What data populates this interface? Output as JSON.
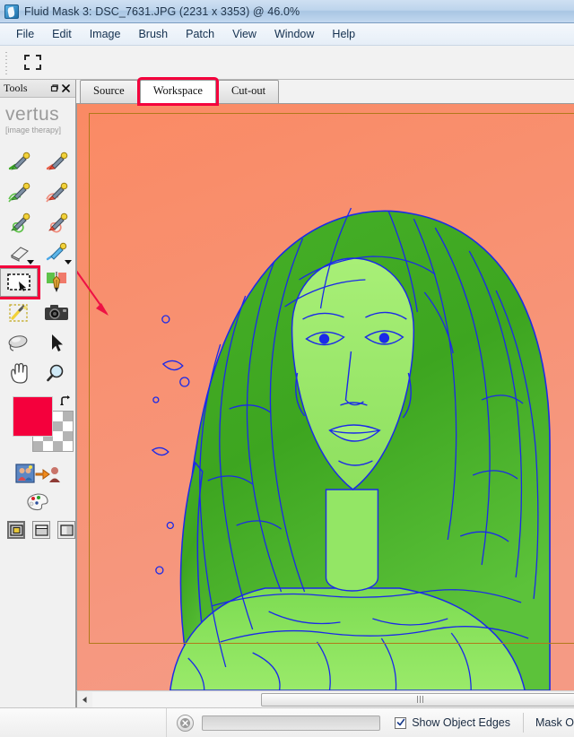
{
  "window": {
    "title": "Fluid Mask 3: DSC_7631.JPG (2231 x 3353) @ 46.0%",
    "app_icon": "fluid-mask-app-icon"
  },
  "menubar": {
    "items": [
      {
        "label": "File"
      },
      {
        "label": "Edit"
      },
      {
        "label": "Image"
      },
      {
        "label": "Brush"
      },
      {
        "label": "Patch"
      },
      {
        "label": "View"
      },
      {
        "label": "Window"
      },
      {
        "label": "Help"
      }
    ]
  },
  "toolstrip": {
    "grip": "drag-grip",
    "buttons": [
      {
        "name": "marquee-select-button",
        "icon": "dashed-rectangle-icon"
      }
    ]
  },
  "tools_panel": {
    "title": "Tools",
    "restore_icon": "restore-window-icon",
    "close_icon": "close-icon",
    "brand": {
      "name": "vertus",
      "tagline": "[image therapy]"
    },
    "tools": [
      {
        "name": "keep-marker-tool",
        "icon": "green-marker-pen-icon",
        "selected": false
      },
      {
        "name": "delete-marker-tool",
        "icon": "red-marker-pen-icon",
        "selected": false
      },
      {
        "name": "keep-edge-marker-tool",
        "icon": "green-curve-pen-icon",
        "selected": false
      },
      {
        "name": "delete-edge-marker-tool",
        "icon": "red-curve-pen-icon",
        "selected": false
      },
      {
        "name": "keep-fill-tool",
        "icon": "green-spiral-pen-icon",
        "selected": false
      },
      {
        "name": "delete-fill-tool",
        "icon": "red-spiral-pen-icon",
        "selected": false
      },
      {
        "name": "eraser-tool",
        "icon": "eraser-icon",
        "selected": false,
        "has_dropdown": true
      },
      {
        "name": "blend-brush-tool",
        "icon": "blue-pen-icon",
        "selected": false,
        "has_dropdown": true
      },
      {
        "name": "rectangle-select-tool",
        "icon": "dashed-rectangle-arrow-icon",
        "selected": true
      },
      {
        "name": "object-pen-tool",
        "icon": "fountain-pen-icon",
        "selected": false
      },
      {
        "name": "magic-wand-tool",
        "icon": "magic-wand-icon",
        "selected": false
      },
      {
        "name": "snapshot-tool",
        "icon": "camera-icon",
        "selected": false
      },
      {
        "name": "blend-exclude-tool",
        "icon": "blob-icon",
        "selected": false
      },
      {
        "name": "pointer-tool",
        "icon": "arrow-pointer-icon",
        "selected": false
      },
      {
        "name": "hand-tool",
        "icon": "hand-icon",
        "selected": false
      },
      {
        "name": "zoom-tool",
        "icon": "magnifier-icon",
        "selected": false
      }
    ],
    "color": {
      "foreground_hex": "#f4003c",
      "background": "transparent-checker",
      "swap_icon": "swap-colors-icon"
    },
    "extra_tools": [
      {
        "name": "image-transform-tool",
        "icon": "photo-transform-icon"
      },
      {
        "name": "palette-tool",
        "icon": "artist-palette-icon"
      }
    ],
    "view_modes": [
      {
        "name": "view-mode-single",
        "icon": "single-pane-icon",
        "active": true
      },
      {
        "name": "view-mode-split",
        "icon": "split-pane-icon",
        "active": false
      },
      {
        "name": "view-mode-preview",
        "icon": "preview-pane-icon",
        "active": false
      }
    ]
  },
  "tabs": [
    {
      "label": "Source",
      "active": false
    },
    {
      "label": "Workspace",
      "active": true
    },
    {
      "label": "Cut-out",
      "active": false
    }
  ],
  "canvas": {
    "background_hex": "#fa8a64",
    "keep_hex": "#3aa520",
    "keep_light_hex": "#96e86a",
    "edge_hex": "#1b2ae8",
    "selection_border_hex": "#b1791b",
    "annotation_arrow_hex": "#ee1144",
    "subject": "portrait-of-woman-with-long-hair"
  },
  "scrollbar": {
    "left_arrow_icon": "scroll-left-arrow-icon",
    "thumb_grip_icon": "scrollbar-grip-icon"
  },
  "statusbar": {
    "stop_button_icon": "stop-cancel-icon",
    "progress_value": "",
    "show_object_edges": {
      "label": "Show Object Edges",
      "checked": true,
      "check_icon": "checkmark-icon"
    },
    "mask_label": "Mask O"
  }
}
